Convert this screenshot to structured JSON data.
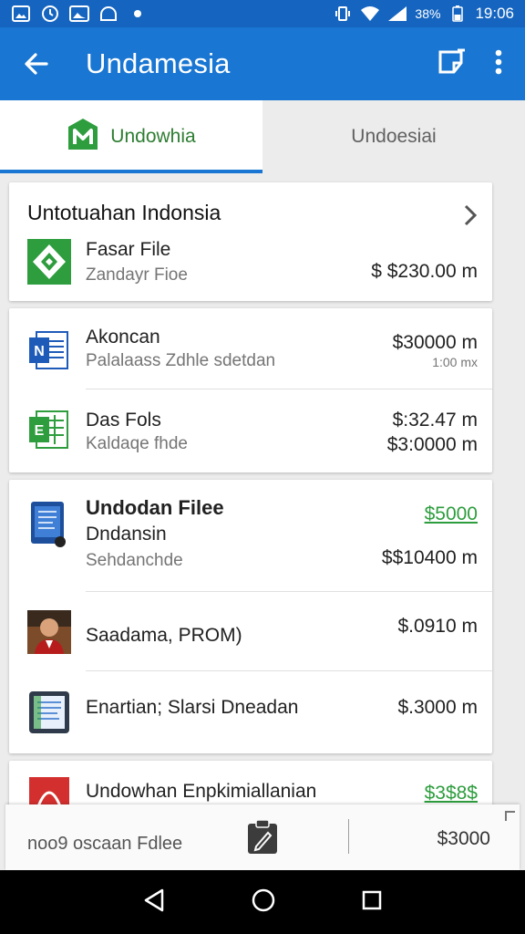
{
  "status_bar": {
    "battery": "38%",
    "time": "19:06"
  },
  "app_bar": {
    "title": "Undamesia"
  },
  "tabs": [
    {
      "label": "Undowhia"
    },
    {
      "label": "Undoesiai"
    }
  ],
  "section": {
    "title": "Untotuahan Indonsia"
  },
  "cards": {
    "c1": {
      "name": "Fasar File",
      "sub": "Zandayr Fioe",
      "amount": "$ $230.00 m"
    },
    "c2a": {
      "name": "Akoncan",
      "sub": "Palalaass Zdhle sdetdan",
      "amount": "$30000 m",
      "amount2": "1:00 mx"
    },
    "c2b": {
      "name": "Das Fols",
      "sub": "Kaldaqe fhde",
      "amount": "$:32.47 m",
      "amount2": "$3:0000 m"
    },
    "c3a": {
      "name": "Undodan Filee",
      "name2": "Dndansin",
      "sub": "Sehdanchde",
      "amount": "$$10400 m",
      "link": "$5000"
    },
    "c3b": {
      "name": "Saadama, PROM)",
      "amount": "$.0910 m"
    },
    "c3c": {
      "name": "Enartian; Slarsi Dneadan",
      "amount": "$.3000 m"
    },
    "c4": {
      "name": "Undowhan Enpkimiallanian",
      "link": "$3$8$"
    }
  },
  "bottom_bar": {
    "left_text": "noo9 oscaan Fdlee",
    "amount": "$3000"
  },
  "colors": {
    "app_bar": "#1976d2",
    "status_bar": "#1565c0",
    "accent_green": "#2e9d3e",
    "tab_indicator": "#1976d2"
  }
}
